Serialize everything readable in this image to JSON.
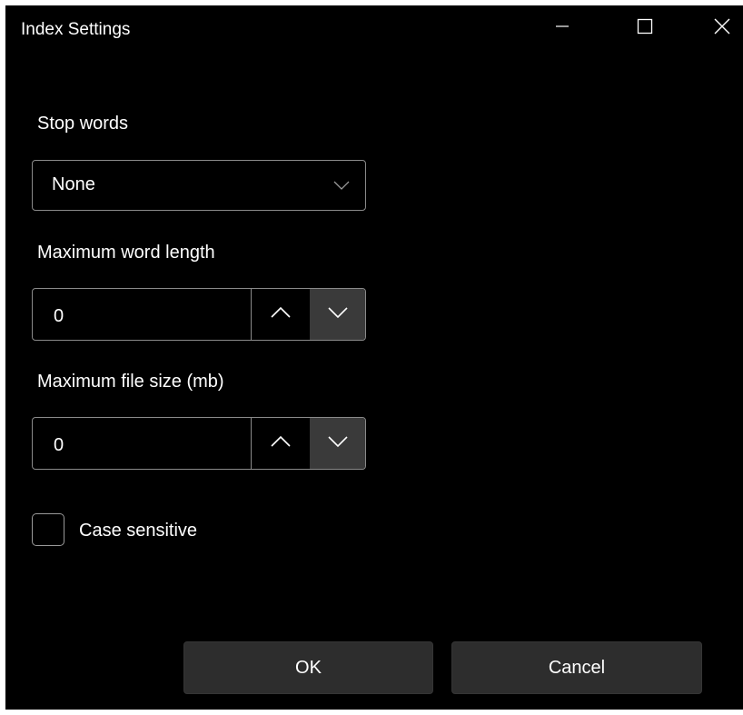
{
  "window": {
    "title": "Index Settings",
    "controls": {
      "minimize_icon": "minimize-icon",
      "maximize_icon": "maximize-icon",
      "close_icon": "close-icon"
    }
  },
  "form": {
    "stop_words": {
      "label": "Stop words",
      "selected": "None",
      "icon": "chevron-down-icon"
    },
    "max_word_length": {
      "label": "Maximum word length",
      "value": "0",
      "up_icon": "chevron-up-icon",
      "down_icon": "chevron-down-icon"
    },
    "max_file_size": {
      "label": "Maximum file size (mb)",
      "value": "0",
      "up_icon": "chevron-up-icon",
      "down_icon": "chevron-down-icon"
    },
    "case_sensitive": {
      "label": "Case sensitive",
      "checked": false
    }
  },
  "actions": {
    "ok_label": "OK",
    "cancel_label": "Cancel"
  },
  "colors": {
    "background": "#000000",
    "text": "#ffffff",
    "border": "#8a8a8a",
    "button_bg": "#2d2d2d",
    "spinner_down_bg": "#3a3a3a"
  }
}
